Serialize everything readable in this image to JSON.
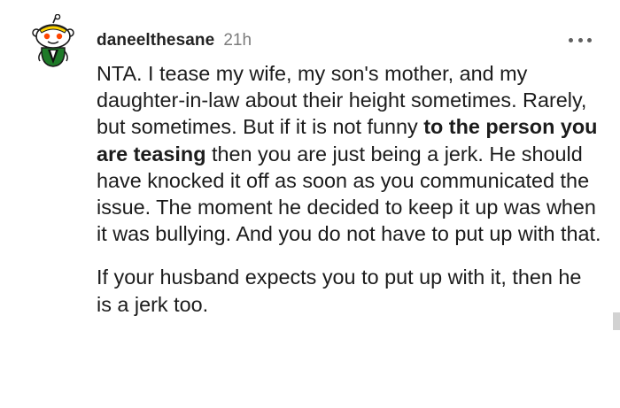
{
  "comment": {
    "author": "daneelthesane",
    "time_ago": "21h",
    "paragraph1": {
      "before_bold": "NTA. I tease my wife, my son's mother, and my daughter-in-law about their height sometimes. Rarely, but sometimes. But if it is not funny ",
      "bold": "to the person you are teasing",
      "after_bold": " then you are just being a jerk. He should have knocked it off as soon as you communicated the issue. The moment he decided to keep it up was when it was bullying. And you do not have to put up with that."
    },
    "paragraph2": "If your husband expects you to put up with it, then he is a jerk too."
  },
  "icons": {
    "avatar": "snoo-avatar-icon",
    "more": "more-options-icon"
  },
  "colors": {
    "text": "#1c1c1c",
    "meta": "#7c7c7c",
    "avatar_green": "#1e7a28",
    "avatar_yellow": "#ffd400"
  }
}
